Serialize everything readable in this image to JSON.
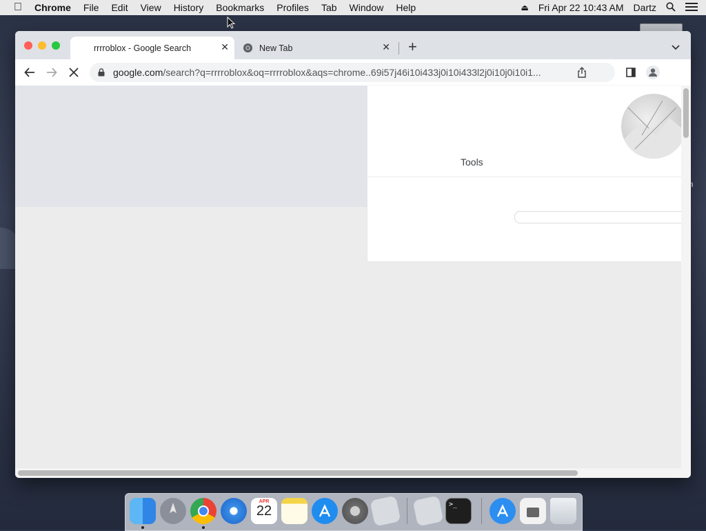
{
  "menubar": {
    "app_name": "Chrome",
    "items": [
      "File",
      "Edit",
      "View",
      "History",
      "Bookmarks",
      "Profiles",
      "Tab",
      "Window",
      "Help"
    ],
    "datetime": "Fri Apr 22  10:43 AM",
    "user": "Dartz"
  },
  "wallpaper_label": "m",
  "tabs": [
    {
      "title": "rrrroblox - Google Search"
    },
    {
      "title": "New Tab"
    }
  ],
  "toolbar": {
    "url_host": "google.com",
    "url_rest": "/search?q=rrrroblox&oq=rrrroblox&aqs=chrome..69i57j46i10i433j0i10i433l2j0i10j0i10i1..."
  },
  "page": {
    "tools_label": "Tools"
  },
  "dock": {
    "calendar_month": "APR",
    "calendar_day": "22",
    "apps": [
      "Finder",
      "Launchpad",
      "Chrome",
      "Safari",
      "Calendar",
      "Notes",
      "App Store",
      "System Preferences",
      "Roblox",
      "Roblox Studio",
      "Terminal",
      "App Store Downloads",
      "Disk",
      "Trash"
    ]
  },
  "colors": {
    "traffic_red": "#ff5f57",
    "traffic_yellow": "#febc2e",
    "traffic_green": "#28c840"
  }
}
